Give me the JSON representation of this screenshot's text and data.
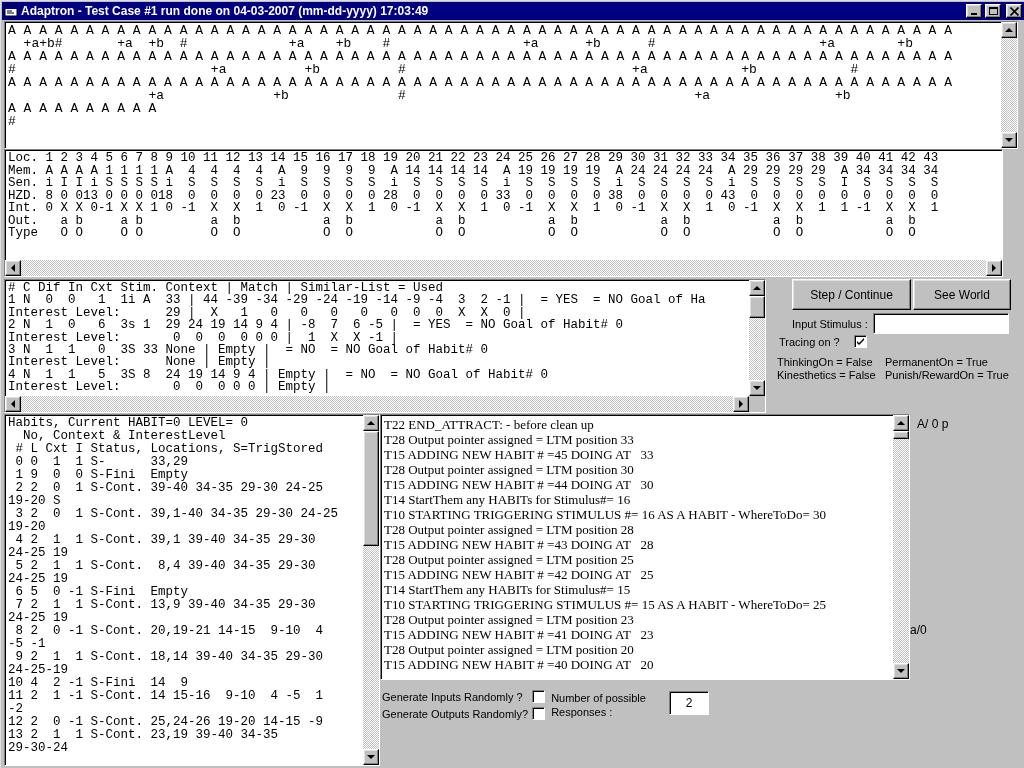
{
  "window": {
    "title": "Adaptron - Test Case #1 run done on 04-03-2007 (mm-dd-yyyy) 17:03:49"
  },
  "world_view": {
    "lines": [
      "A A A A A A A A A A A A A A A A A A A A A A A A A A A A A A A A A A A A A A A A A A A A A A A A A A A A A A A A A A A A A",
      "  +a+b#       +a  +b  #             +a    +b    #                 +a      +b      #                     +a        +b",
      "A A A A A A A A A A A A A A A A A A A A A A A A A A A A A A A A A A A A A A A A A A A A A A A A A A A A A A A A A A A A A",
      "#                         +a          +b          #                             +a            +b            #",
      "A A A A A A A A A A A A A A A A A A A A A A A A A A A A A A A A A A A A A A A A A A A A A A A A A A A A A A A A A A A A A",
      "                  +a              +b              #                                     +a                +b",
      "A A A A A A A A A A",
      "#"
    ]
  },
  "memory_table": {
    "rows": [
      "Loc. 1 2 3 4 5 6 7 8 9 10 11 12 13 14 15 16 17 18 19 20 21 22 23 24 25 26 27 28 29 30 31 32 33 34 35 36 37 38 39 40 41 42 43",
      "Mem. A A A A 1 1 1 1 A  4  4  4  4  A  9  9  9  9  A 14 14 14 14  A 19 19 19 19  A 24 24 24 24  A 29 29 29 29  A 34 34 34 34",
      "Sen. i I I i S S S S i  S  S  S  S  i  S  S  S  S  i  S  S  S  S  i  S  S  S  S  i  S  S  S  S  i  S  S  S  S  I  S  S  S  S",
      "HZD. 8 0 013 0 0 0 018  0  0  0  0 23  0  0  0  0 28  0  0  0  0 33  0  0  0  0 38  0  0  0  0 43  0  0  0  0  0  0  0  0  0",
      "Int. 0 X X 0-1 X X 1 0 -1  X  X  1  0 -1  X  X  1  0 -1  X  X  1  0 -1  X  X  1  0 -1  X  X  1  0 -1  X  X  1  1 -1  X  X  1",
      "Out.   a b     a b         a  b           a  b           a  b           a  b           a  b           a  b           a  b",
      "Type   O O     O O         O  O           O  O           O  O           O  O           O  O           O  O           O  O"
    ]
  },
  "match_list": {
    "lines": [
      "# C Dif In Cxt Stim. Context | Match | Similar-List = Used",
      "1 N  0  0   1  1i A  33 | 44 -39 -34 -29 -24 -19 -14 -9 -4  3  2 -1 |  = YES  = NO Goal of Ha",
      "Interest Level:      29 |  X   1   0   0   0   0   0  0  0  X  X  0 |",
      "2 N  1  0   6  3s 1  29 24 19 14 9 4 | -8  7  6 -5 |  = YES  = NO Goal of Habit# 0",
      "Interest Level:       0  0  0  0 0 0 |  1  X  X -1 |",
      "3 N  1  1   0  3S 33 None | Empty |  = NO  = NO Goal of Habit# 0",
      "Interest Level:      None | Empty |",
      "4 N  1  1   5  3S 8  24 19 14 9 4 | Empty |  = NO  = NO Goal of Habit# 0",
      "Interest Level:       0  0  0 0 0 | Empty |"
    ]
  },
  "controls": {
    "buttons": [
      "Step / Continue",
      "See World"
    ],
    "input_stimulus": {
      "label": "Input Stimulus :"
    },
    "tracing": {
      "label": "Tracing on ?",
      "checked": true
    },
    "flags": [
      "ThinkingOn = False",
      "PermanentOn = True",
      "Kinesthetics = False",
      "Punish/RewardOn = True"
    ]
  },
  "habits": {
    "lines": [
      "Habits, Current HABIT=0 LEVEL= 0",
      "  No, Context & InterestLevel",
      " # L Cxt I Status, Locations, S=TrigStored",
      " 0 0  1  1 S-      33,29",
      " 1 9  0  0 S-Fini  Empty",
      " 2 2  0  1 S-Cont. 39-40 34-35 29-30 24-25",
      "19-20 S",
      " 3 2  0  1 S-Cont. 39,1-40 34-35 29-30 24-25",
      "19-20",
      " 4 2  1  1 S-Cont. 39,1 39-40 34-35 29-30",
      "24-25 19",
      " 5 2  1  1 S-Cont.  8,4 39-40 34-35 29-30",
      "24-25 19",
      " 6 5  0 -1 S-Fini  Empty",
      " 7 2  1  1 S-Cont. 13,9 39-40 34-35 29-30",
      "24-25 19",
      " 8 2  0 -1 S-Cont. 20,19-21 14-15  9-10  4",
      "-5 -1",
      " 9 2  1  1 S-Cont. 18,14 39-40 34-35 29-30",
      "24-25-19",
      "10 4  2 -1 S-Fini  14  9",
      "11 2  1 -1 S-Cont. 14 15-16  9-10  4 -5  1",
      "-2",
      "12 2  0 -1 S-Cont. 25,24-26 19-20 14-15 -9",
      "13 2  1  1 S-Cont. 23,19 39-40 34-35",
      "29-30-24"
    ]
  },
  "trace_log": {
    "lines": [
      "T22 END_ATTRACT: - before clean up",
      "T28 Output pointer assigned = LTM position 33",
      "T15 ADDING NEW HABIT # =45 DOING AT   33",
      "T28 Output pointer assigned = LTM position 30",
      "T15 ADDING NEW HABIT # =44 DOING AT   30",
      "T14 StartThem any HABITs for Stimulus#= 16",
      "T10 STARTING TRIGGERING STIMULUS #= 16 AS A HABIT - WhereToDo= 30",
      "T28 Output pointer assigned = LTM position 28",
      "T15 ADDING NEW HABIT # =43 DOING AT   28",
      "T28 Output pointer assigned = LTM position 25",
      "T15 ADDING NEW HABIT # =42 DOING AT   25",
      "T14 StartThem any HABITs for Stimulus#= 15",
      "T10 STARTING TRIGGERING STIMULUS #= 15 AS A HABIT - WhereToDo= 25",
      "T28 Output pointer assigned = LTM position 23",
      "T15 ADDING NEW HABIT # =41 DOING AT   23",
      "T28 Output pointer assigned = LTM position 20",
      "T15 ADDING NEW HABIT # =40 DOING AT   20"
    ]
  },
  "side_labels": [
    "A/ 0 p",
    "a/0"
  ],
  "generate_inputs": {
    "label": "Generate Inputs Randomly ?",
    "checked": false
  },
  "generate_outputs": {
    "label": "Generate Outputs Randomly?",
    "checked": false
  },
  "responses": {
    "label": "Number of possible Responses :",
    "value": "2"
  }
}
